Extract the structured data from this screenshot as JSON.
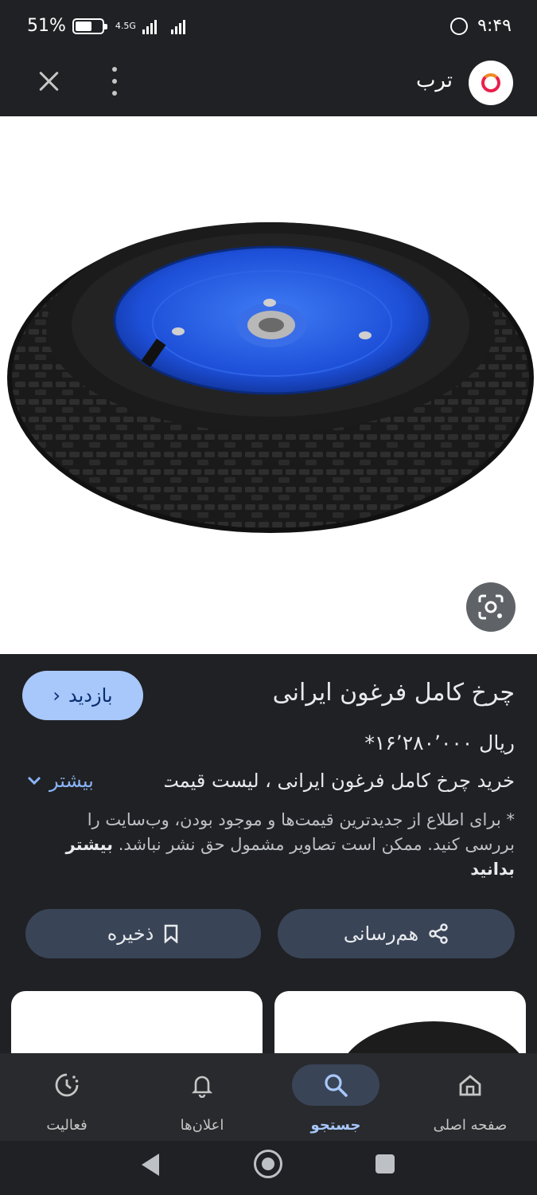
{
  "status_bar": {
    "battery": "51%",
    "network": "4.5G",
    "time": "۹:۴۹"
  },
  "header": {
    "site_name": "ترب",
    "logo": "torob-logo",
    "close_icon": "close-icon",
    "menu_icon": "more-vert-icon"
  },
  "product": {
    "title": "چرخ کامل فرغون ایرانی",
    "price": "ریال ۱۶٬۲۸۰٬۰۰۰*",
    "description": "خرید چرخ کامل فرغون ایرانی ، لیست قیمت...",
    "more_label": "بیشتر",
    "disclaimer_text": "* برای اطلاع از جدیدترین قیمت‌ها و موجود بودن، وب‌سایت را بررسی کنید. ممکن است تصاویر مشمول حق نشر نباشد.",
    "disclaimer_link": "بیشتر بدانید"
  },
  "actions": {
    "visit_label": "بازدید",
    "share_label": "هم‌رسانی",
    "save_label": "ذخیره"
  },
  "bottom_nav": [
    {
      "label": "صفحه اصلی",
      "icon": "home-icon"
    },
    {
      "label": "جستجو",
      "icon": "search-icon",
      "active": true
    },
    {
      "label": "اعلان‌ها",
      "icon": "bell-icon"
    },
    {
      "label": "فعالیت",
      "icon": "activity-icon"
    }
  ],
  "colors": {
    "background": "#202124",
    "accent": "#a8c7fa",
    "pill": "#394457",
    "rim_blue": "#1d4fd8"
  }
}
